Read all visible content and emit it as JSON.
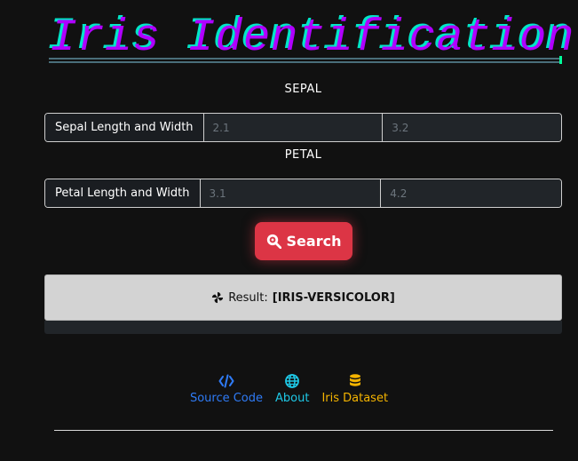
{
  "title": "Iris Identification",
  "sepal": {
    "section_label": "SEPAL",
    "group_label": "Sepal Length and Width",
    "length_placeholder": "2.1",
    "width_placeholder": "3.2"
  },
  "petal": {
    "section_label": "PETAL",
    "group_label": "Petal Length and Width",
    "length_placeholder": "3.1",
    "width_placeholder": "4.2"
  },
  "search_button": {
    "label": "Search",
    "icon": "search-magnifier-icon"
  },
  "result": {
    "prefix": "Result:",
    "value": "[IRIS-VERSICOLOR]",
    "icon": "pinwheel-icon"
  },
  "footer": {
    "links": [
      {
        "label": "Source Code",
        "icon": "code-icon",
        "color": "#2f7bf6"
      },
      {
        "label": "About",
        "icon": "globe-icon",
        "color": "#1ec8e6"
      },
      {
        "label": "Iris Dataset",
        "icon": "database-icon",
        "color": "#f5b400"
      }
    ]
  },
  "colors": {
    "background": "#111111",
    "title": "#b000ff",
    "title_shadow": "#00e5c8",
    "search_button": "#dc3545",
    "result_box": "#d3d3d3"
  }
}
